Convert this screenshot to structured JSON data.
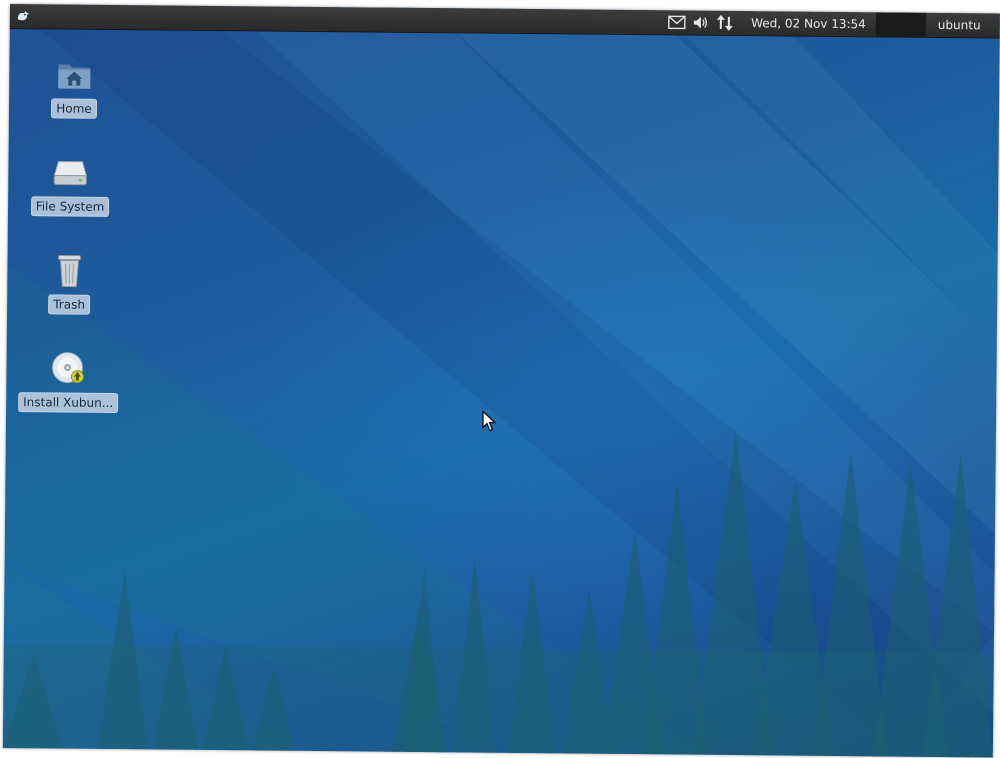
{
  "panel": {
    "menu_icon": "xfce-mouse-icon",
    "tray_icons": [
      "mail-icon",
      "volume-icon",
      "network-arrows-icon"
    ],
    "clock": "Wed, 02 Nov  13:54",
    "user": "ubuntu"
  },
  "desktop": {
    "icons": [
      {
        "label": "Home",
        "icon": "home-folder-icon"
      },
      {
        "label": "File System",
        "icon": "drive-icon"
      },
      {
        "label": "Trash",
        "icon": "trash-icon"
      },
      {
        "label": "Install Xubun...",
        "icon": "install-disc-icon"
      }
    ]
  },
  "colors": {
    "panel": "#2f2f2f",
    "wallpaper_dark": "#17438a",
    "wallpaper_mid": "#1a6aa6",
    "label_bg": "#d2deec"
  }
}
